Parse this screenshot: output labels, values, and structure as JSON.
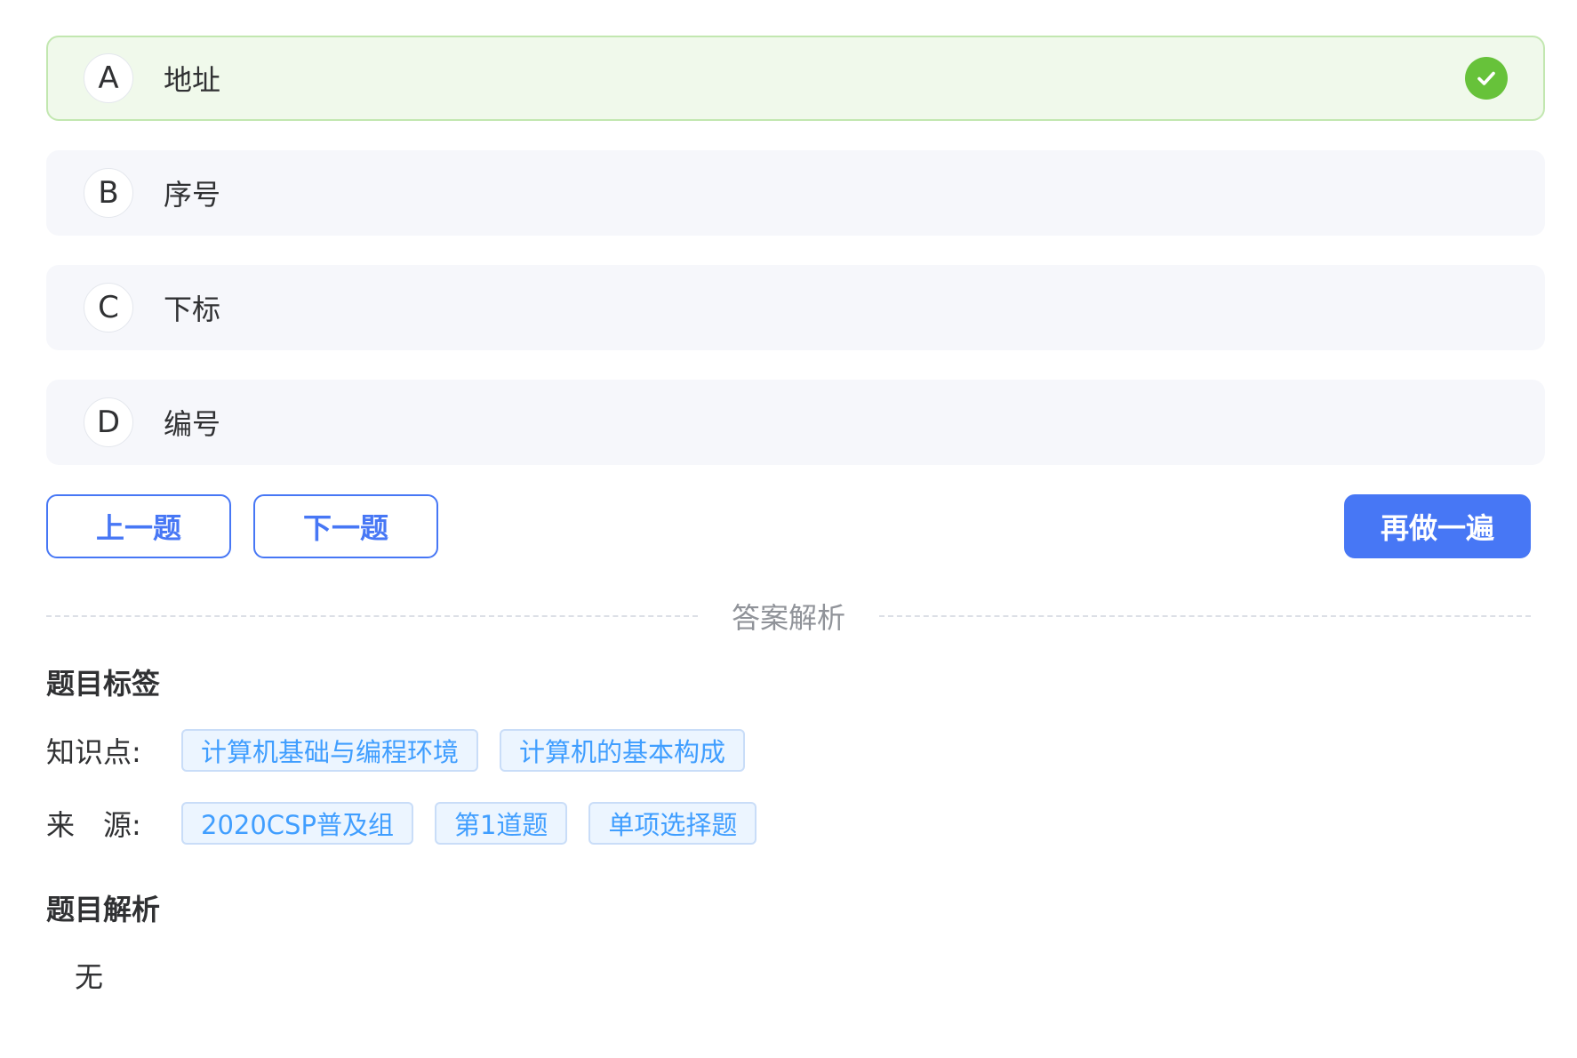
{
  "options": [
    {
      "letter": "A",
      "text": "地址",
      "status": "correct"
    },
    {
      "letter": "B",
      "text": "序号",
      "status": "normal"
    },
    {
      "letter": "C",
      "text": "下标",
      "status": "normal"
    },
    {
      "letter": "D",
      "text": "编号",
      "status": "normal"
    }
  ],
  "buttons": {
    "prev_label": "上一题",
    "next_label": "下一题",
    "redo_label": "再做一遍"
  },
  "divider": {
    "label": "答案解析"
  },
  "tags_section": {
    "title": "题目标签",
    "knowledge_label": "知识点:",
    "knowledge_tags": [
      "计算机基础与编程环境",
      "计算机的基本构成"
    ],
    "source_label": "来　源:",
    "source_tags": [
      "2020CSP普及组",
      "第1道题",
      "单项选择题"
    ]
  },
  "analysis_section": {
    "title": "题目解析",
    "content": "无"
  },
  "colors": {
    "primary": "#4777f5",
    "correct_green": "#67c23a",
    "correct_bg": "#f0f9eb",
    "option_bg": "#f6f7fb",
    "tag_text": "#409eff",
    "tag_bg": "#ecf5ff"
  },
  "icons": {
    "correct": "check-circle-icon"
  }
}
